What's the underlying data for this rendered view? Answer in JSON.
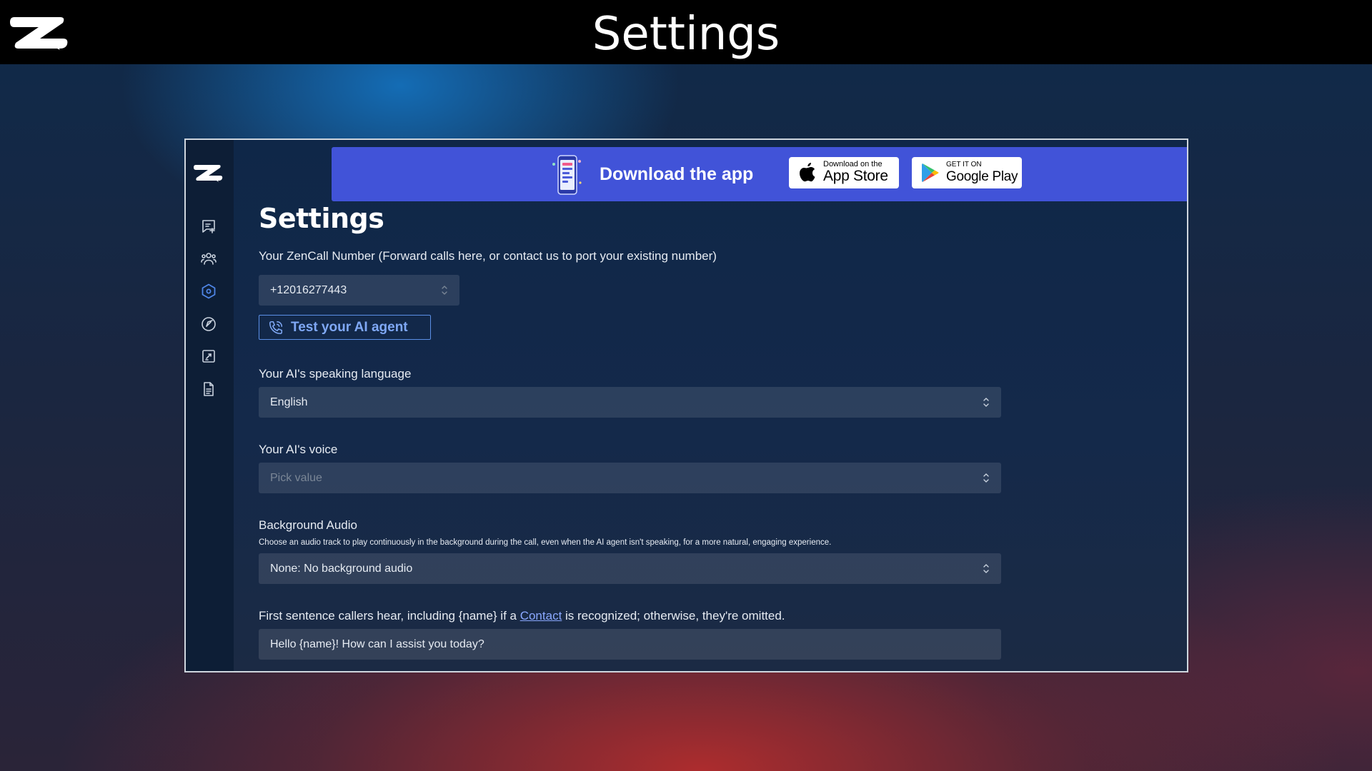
{
  "header": {
    "title": "Settings"
  },
  "sidebar": {
    "items": [
      {
        "icon": "new-chat-icon"
      },
      {
        "icon": "contacts-icon"
      },
      {
        "icon": "settings-hex-icon",
        "active": true
      },
      {
        "icon": "compass-icon"
      },
      {
        "icon": "integrations-icon"
      },
      {
        "icon": "document-icon"
      }
    ]
  },
  "banner": {
    "text": "Download the app",
    "appstore_small": "Download on the",
    "appstore_big": "App Store",
    "googleplay_small": "GET IT ON",
    "googleplay_big": "Google Play"
  },
  "page": {
    "title": "Settings",
    "number_label": "Your ZenCall Number (Forward calls here, or contact us to port your existing number)",
    "number_value": "+12016277443",
    "test_button": "Test your AI agent",
    "language_label": "Your AI's speaking language",
    "language_value": "English",
    "voice_label": "Your AI's voice",
    "voice_placeholder": "Pick value",
    "bg_audio_label": "Background Audio",
    "bg_audio_desc": "Choose an audio track to play continuously in the background during the call, even when the AI agent isn't speaking, for a more natural, engaging experience.",
    "bg_audio_value": "None: No background audio",
    "first_sentence_label_before": "First sentence callers hear, including {name} if a ",
    "first_sentence_label_link": "Contact",
    "first_sentence_label_after": " is recognized; otherwise, they're omitted.",
    "first_sentence_value": "Hello {name}! How can I assist you today?"
  },
  "colors": {
    "banner": "#4153d8",
    "accent": "#5b8fe6",
    "active_icon": "#4f86e8"
  }
}
